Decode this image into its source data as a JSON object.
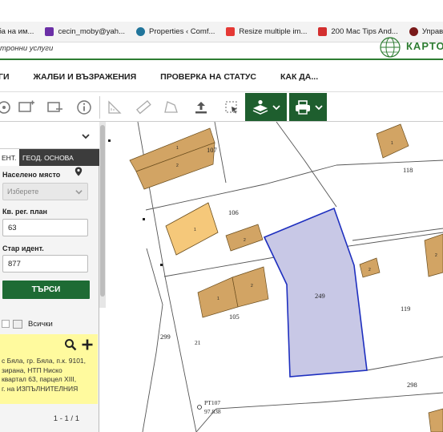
{
  "browser": {
    "bookmarks": [
      {
        "label": "кба на им...",
        "color": "#3a6fd8"
      },
      {
        "label": "cecin_moby@yah...",
        "color": "#6b2fa6"
      },
      {
        "label": "Properties ‹ Comf...",
        "color": "#21759b"
      },
      {
        "label": "Resize multiple im...",
        "color": "#e53935"
      },
      {
        "label": "200 Mac Tips And...",
        "color": "#d32f2f"
      },
      {
        "label": "Управлен",
        "color": "#7a1a1a"
      }
    ]
  },
  "header": {
    "subtitle": "тронни услуги",
    "logo_text": "КАРТО"
  },
  "nav": {
    "items": [
      "ГИ",
      "ЖАЛБИ И ВЪЗРАЖЕНИЯ",
      "ПРОВЕРКА НА СТАТУС",
      "КАК ДА..."
    ]
  },
  "panel": {
    "tabs": [
      "ЕНТ.",
      "ГЕОД. ОСНОВА"
    ],
    "settlement_label": "Населено място",
    "settlement_placeholder": "Изберете",
    "cad_label": "Кв. рег. план",
    "cad_value": "63",
    "old_label": "Стар идент.",
    "old_value": "877",
    "search_label": "ТЪРСИ",
    "all_label": "Всички",
    "result_lines": [
      "с Бяла, гр. Бяла, п.к. 9101,",
      "зирана, НТП Ниско",
      "квартал 63, парцел XIII,",
      "г. на ИЗПЪЛНИТЕЛНИЯ"
    ],
    "pager": "1 - 1 / 1"
  },
  "map": {
    "parcel_labels": [
      "107",
      "118",
      "106",
      "249",
      "119",
      "105",
      "299",
      "298",
      "21"
    ],
    "building_labels": [
      "1",
      "2",
      "1",
      "2",
      "1",
      "2",
      "2",
      "1",
      "2"
    ],
    "point_label": "РТ107",
    "point_value": "97.838",
    "selected_color": "#c8c8e6",
    "building_color": "#d2a464",
    "highlight_building_color": "#f5c87a"
  }
}
